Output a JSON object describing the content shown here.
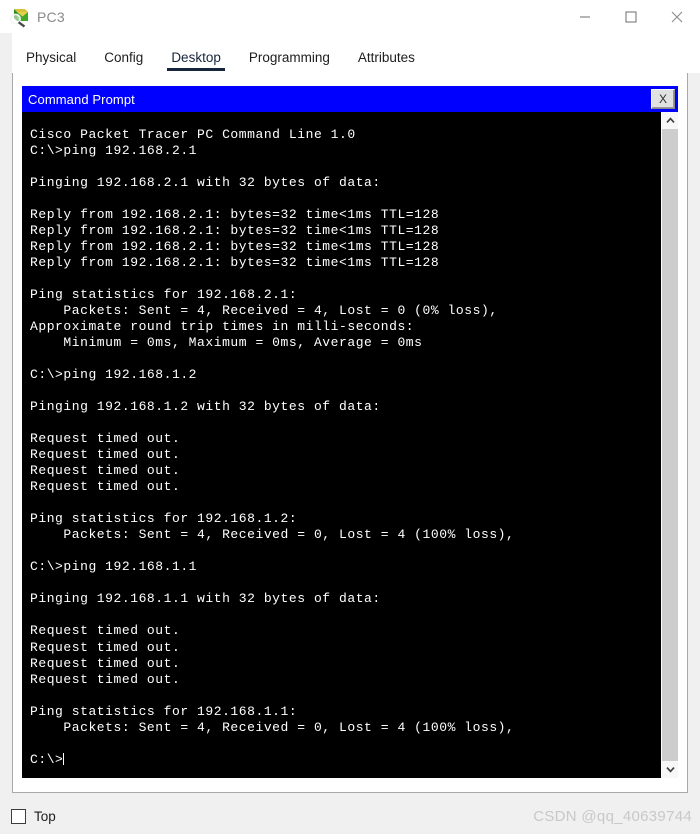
{
  "window": {
    "title": "PC3",
    "icon": "packet-tracer-pc-icon",
    "controls": {
      "minimize_label": "—",
      "maximize_label": "□",
      "close_label": "✕"
    }
  },
  "tabs": [
    {
      "label": "Physical",
      "active": false
    },
    {
      "label": "Config",
      "active": false
    },
    {
      "label": "Desktop",
      "active": true
    },
    {
      "label": "Programming",
      "active": false
    },
    {
      "label": "Attributes",
      "active": false
    }
  ],
  "command_prompt": {
    "title": "Command Prompt",
    "close_label": "X",
    "colors": {
      "titlebar_bg": "#0000ff",
      "titlebar_fg": "#ffffff",
      "terminal_bg": "#000000",
      "terminal_fg": "#ffffff",
      "tab_accent": "#16253c"
    },
    "lines": [
      "Cisco Packet Tracer PC Command Line 1.0",
      "C:\\>ping 192.168.2.1",
      "",
      "Pinging 192.168.2.1 with 32 bytes of data:",
      "",
      "Reply from 192.168.2.1: bytes=32 time<1ms TTL=128",
      "Reply from 192.168.2.1: bytes=32 time<1ms TTL=128",
      "Reply from 192.168.2.1: bytes=32 time<1ms TTL=128",
      "Reply from 192.168.2.1: bytes=32 time<1ms TTL=128",
      "",
      "Ping statistics for 192.168.2.1:",
      "    Packets: Sent = 4, Received = 4, Lost = 0 (0% loss),",
      "Approximate round trip times in milli-seconds:",
      "    Minimum = 0ms, Maximum = 0ms, Average = 0ms",
      "",
      "C:\\>ping 192.168.1.2",
      "",
      "Pinging 192.168.1.2 with 32 bytes of data:",
      "",
      "Request timed out.",
      "Request timed out.",
      "Request timed out.",
      "Request timed out.",
      "",
      "Ping statistics for 192.168.1.2:",
      "    Packets: Sent = 4, Received = 0, Lost = 4 (100% loss),",
      "",
      "C:\\>ping 192.168.1.1",
      "",
      "Pinging 192.168.1.1 with 32 bytes of data:",
      "",
      "Request timed out.",
      "Request timed out.",
      "Request timed out.",
      "Request timed out.",
      "",
      "Ping statistics for 192.168.1.1:",
      "    Packets: Sent = 4, Received = 0, Lost = 4 (100% loss),",
      ""
    ],
    "prompt": "C:\\>"
  },
  "scrollbar": {
    "up_icon": "chevron-up-icon",
    "down_icon": "chevron-down-icon"
  },
  "footer": {
    "top_checkbox_label": "Top",
    "top_checkbox_checked": false,
    "watermark": "CSDN @qq_40639744"
  }
}
